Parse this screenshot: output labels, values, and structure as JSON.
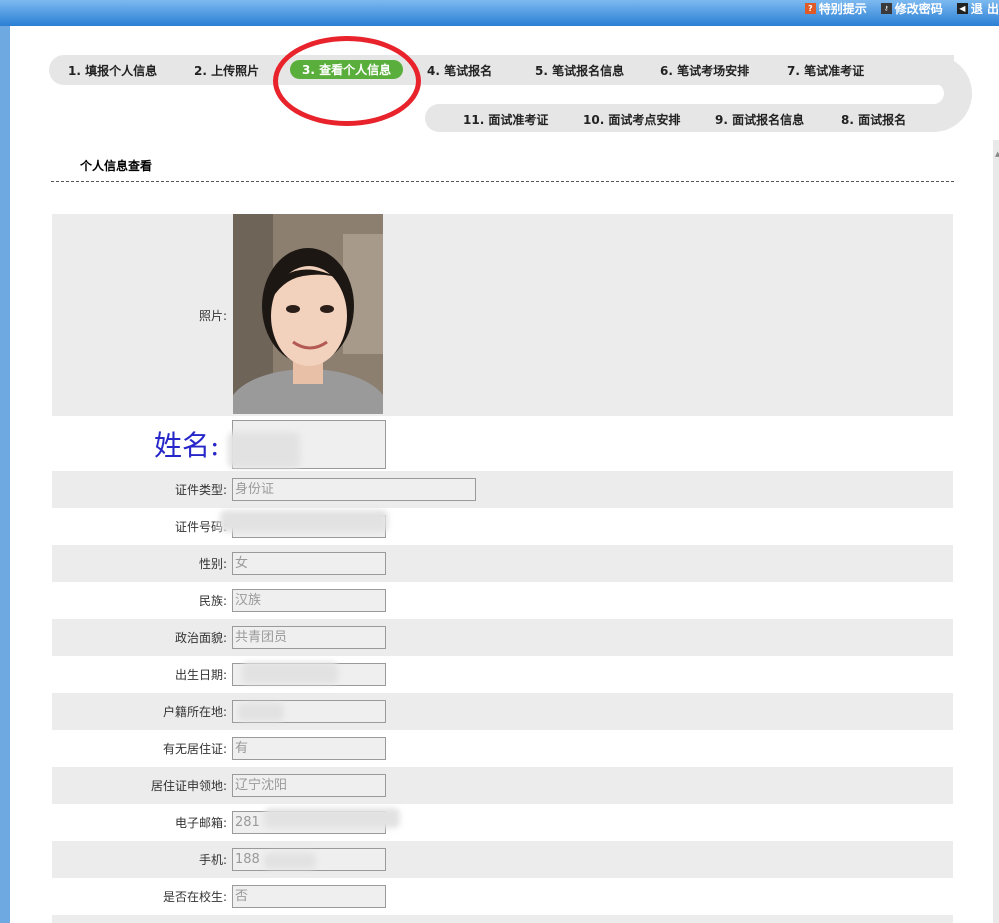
{
  "header": {
    "links": [
      {
        "label": "特别提示",
        "icon": "help-icon"
      },
      {
        "label": "修改密码",
        "icon": "key-icon"
      },
      {
        "label": "退 出",
        "icon": "exit-icon"
      }
    ]
  },
  "steps": [
    {
      "label": "1. 填报个人信息"
    },
    {
      "label": "2. 上传照片"
    },
    {
      "label": "3. 查看个人信息",
      "active": true
    },
    {
      "label": "4. 笔试报名"
    },
    {
      "label": "5. 笔试报名信息"
    },
    {
      "label": "6. 笔试考场安排"
    },
    {
      "label": "7. 笔试准考证"
    },
    {
      "label": "11. 面试准考证"
    },
    {
      "label": "10. 面试考点安排"
    },
    {
      "label": "9. 面试报名信息"
    },
    {
      "label": "8. 面试报名"
    }
  ],
  "page": {
    "section_title": "个人信息查看"
  },
  "form": {
    "photo_label": "照片:",
    "name_label": "姓名:",
    "fields": [
      {
        "label": "证件类型:",
        "value": "身份证"
      },
      {
        "label": "证件号码:",
        "value": ""
      },
      {
        "label": "性别:",
        "value": "女"
      },
      {
        "label": "民族:",
        "value": "汉族"
      },
      {
        "label": "政治面貌:",
        "value": "共青团员"
      },
      {
        "label": "出生日期:",
        "value": ""
      },
      {
        "label": "户籍所在地:",
        "value": ""
      },
      {
        "label": "有无居住证:",
        "value": "有"
      },
      {
        "label": "居住证申领地:",
        "value": "辽宁沈阳"
      },
      {
        "label": "电子邮箱:",
        "value": "281"
      },
      {
        "label": "手机:",
        "value": "188"
      },
      {
        "label": "是否在校生:",
        "value": "否"
      }
    ]
  },
  "colors": {
    "accent_blue": "#2a7fd4",
    "active_step": "#5aae3c",
    "highlight_circle": "#e8232b",
    "name_label": "#2727c9"
  }
}
